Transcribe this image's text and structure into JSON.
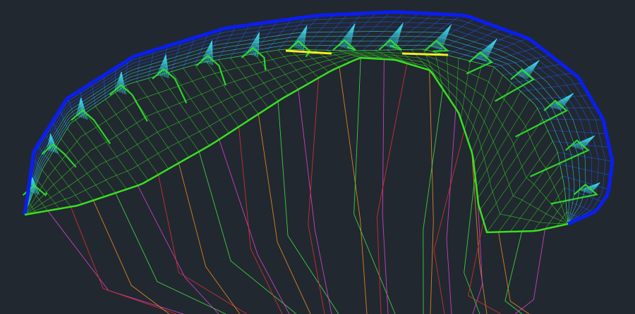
{
  "viewport": {
    "background": "#212830",
    "subject": "paraglider-wing-wireframe"
  },
  "colors": {
    "leading_edge": "#0a1ef0",
    "surface_blue": "#1e5aff",
    "ribs_cyan": "#3ad6e6",
    "ribs_green": "#2ee82a",
    "lower_surface": "#38e020",
    "highlight_yellow": "#f0f020",
    "line_magenta": "#e040d0",
    "line_red": "#e03030",
    "line_orange": "#f08a20",
    "line_green": "#40e040"
  }
}
